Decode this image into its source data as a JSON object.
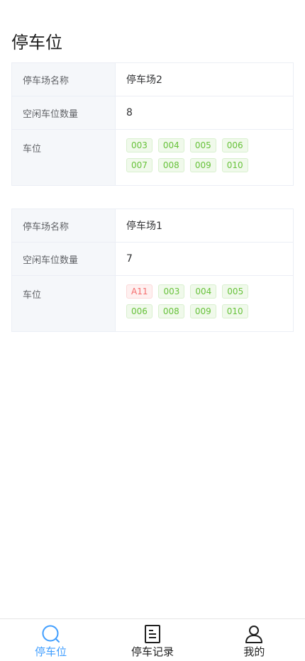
{
  "page": {
    "title": "停车位"
  },
  "lots": [
    {
      "name_label": "停车场名称",
      "name": "停车场2",
      "free_label": "空闲车位数量",
      "free_count": "8",
      "spots_label": "车位",
      "spots": [
        {
          "code": "003",
          "status": "free"
        },
        {
          "code": "004",
          "status": "free"
        },
        {
          "code": "005",
          "status": "free"
        },
        {
          "code": "006",
          "status": "free"
        },
        {
          "code": "007",
          "status": "free"
        },
        {
          "code": "008",
          "status": "free"
        },
        {
          "code": "009",
          "status": "free"
        },
        {
          "code": "010",
          "status": "free"
        }
      ]
    },
    {
      "name_label": "停车场名称",
      "name": "停车场1",
      "free_label": "空闲车位数量",
      "free_count": "7",
      "spots_label": "车位",
      "spots": [
        {
          "code": "A11",
          "status": "occupied"
        },
        {
          "code": "003",
          "status": "free"
        },
        {
          "code": "004",
          "status": "free"
        },
        {
          "code": "005",
          "status": "free"
        },
        {
          "code": "006",
          "status": "free"
        },
        {
          "code": "008",
          "status": "free"
        },
        {
          "code": "009",
          "status": "free"
        },
        {
          "code": "010",
          "status": "free"
        }
      ]
    }
  ],
  "tabbar": {
    "items": [
      {
        "label": "停车位",
        "icon": "search-icon",
        "active": true
      },
      {
        "label": "停车记录",
        "icon": "document-icon",
        "active": false
      },
      {
        "label": "我的",
        "icon": "user-icon",
        "active": false
      }
    ]
  },
  "colors": {
    "accent": "#409eff",
    "free_tag_text": "#67c23a",
    "free_tag_bg": "#f0f9eb",
    "occupied_tag_text": "#f56c6c",
    "occupied_tag_bg": "#fef0f0",
    "label_cell_bg": "#f5f7fa"
  }
}
